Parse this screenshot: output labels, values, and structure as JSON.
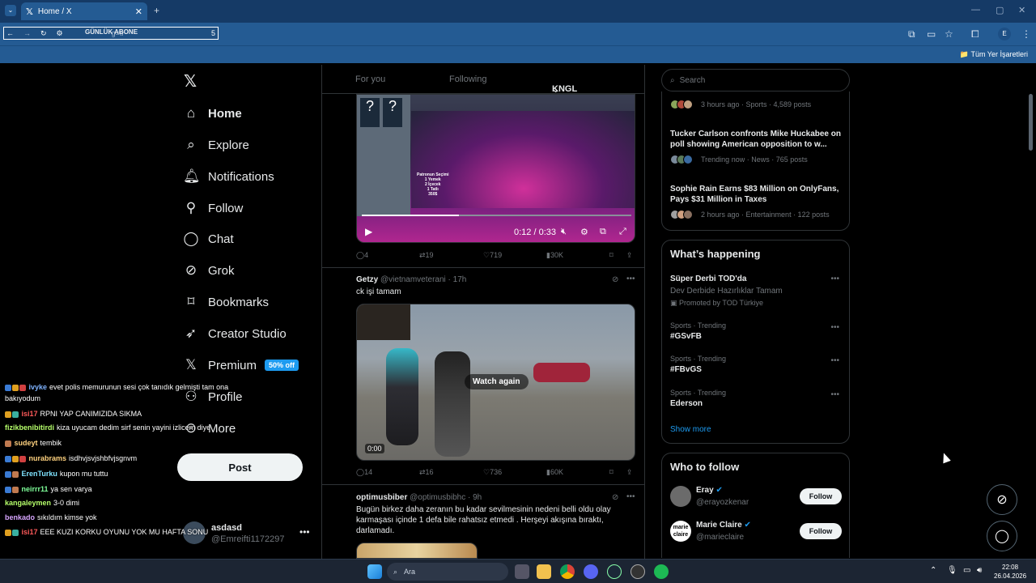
{
  "browser": {
    "tab_title": "Home / X",
    "address_overlay": "GÜNLÜK ABONE",
    "address_hint": "g=tr",
    "address_num": "5",
    "bookmarks_label": "Tüm Yer İşaretleri",
    "profile_letter": "E"
  },
  "nav": {
    "home": "Home",
    "explore": "Explore",
    "notifications": "Notifications",
    "follow": "Follow",
    "chat": "Chat",
    "grok": "Grok",
    "bookmarks": "Bookmarks",
    "creator_studio": "Creator Studio",
    "premium": "Premium",
    "premium_badge": "50% off",
    "profile": "Profile",
    "more": "More",
    "post": "Post"
  },
  "account": {
    "name": "asdasd",
    "handle": "@Emreifti1172297"
  },
  "feed": {
    "tabs": [
      "For you",
      "Following",
      "KNGL Social"
    ],
    "video1": {
      "overlay_lines": [
        "Patronun Seçimi",
        "1 Yemek",
        "2 İçecek",
        "1 Tatlı",
        "350$"
      ],
      "time": "0:12 / 0:33",
      "replies": "4",
      "reposts": "19",
      "likes": "719",
      "views": "30K"
    },
    "tweet2": {
      "name": "Getzy",
      "handle": "@vietnamveterani",
      "time": "· 17h",
      "text": "ck işi tamam",
      "watch_again": "Watch again",
      "video_time": "0:00",
      "replies": "14",
      "reposts": "16",
      "likes": "736",
      "views": "60K"
    },
    "tweet3": {
      "name": "optimusbiber",
      "handle": "@optimusbibhc",
      "time": "· 9h",
      "text": "Bugün birkez daha zeranın bu kadar sevilmesinin nedeni belli oldu olay karmaşası içinde 1 defa bile rahatsız etmedi . Herşeyi akışına bıraktı, darlamadı."
    }
  },
  "right": {
    "search_placeholder": "Search",
    "news": [
      {
        "title": "",
        "meta": "3 hours ago · Sports · 4,589 posts"
      },
      {
        "title": "Tucker Carlson confronts Mike Huckabee on poll showing American opposition to w...",
        "meta": "Trending now · News · 765 posts"
      },
      {
        "title": "Sophie Rain Earns $83 Million on OnlyFans, Pays $31 Million in Taxes",
        "meta": "2 hours ago · Entertainment · 122 posts"
      }
    ],
    "happening_title": "What’s happening",
    "promo": {
      "name": "Süper Derbi TOD'da",
      "desc": "Dev Derbide Hazırlıklar Tamam",
      "promoted": "Promoted by TOD Türkiye"
    },
    "trends": [
      {
        "context": "Sports · Trending",
        "name": "#GSvFB"
      },
      {
        "context": "Sports · Trending",
        "name": "#FBvGS"
      },
      {
        "context": "Sports · Trending",
        "name": "Ederson"
      }
    ],
    "show_more": "Show more",
    "who_title": "Who to follow",
    "who": [
      {
        "name": "Eray",
        "handle": "@erayozkenar",
        "button": "Follow"
      },
      {
        "name": "Marie Claire",
        "handle": "@marieclaire",
        "button": "Follow"
      }
    ]
  },
  "chat_overlay": [
    {
      "user": "ivyke",
      "msg": "evet polis memurunun sesi çok tanıdık gelmişti tam ona",
      "color": "#7fb3ff"
    },
    {
      "user": "",
      "msg": "bakıyodum",
      "color": "#ffffff"
    },
    {
      "user": "isi17",
      "msg": "RPNI YAP CANIMIZIDA SIKMA",
      "color": "#ff5a5a"
    },
    {
      "user": "fizikbenibitirdi",
      "msg": "kiza uyucam dedim sirf senin yayini izlicem diye",
      "color": "#b6ff6b"
    },
    {
      "user": "sudeyt",
      "msg": "tembik",
      "color": "#ffd27f"
    },
    {
      "user": "nurabrams",
      "msg": "isdhvjsvjshbfvjsgnvm",
      "color": "#ffd27f"
    },
    {
      "user": "ErenTurku",
      "msg": "kupon mu tuttu",
      "color": "#7fe3ff"
    },
    {
      "user": "neirrr11",
      "msg": "ya sen varya",
      "color": "#7fff9a"
    },
    {
      "user": "kangaleymen",
      "msg": "3-0 dimi",
      "color": "#b6ff6b"
    },
    {
      "user": "benkado",
      "msg": "sıkıldım kimse yok",
      "color": "#d8a6ff"
    },
    {
      "user": "isi17",
      "msg": "EEE KUZI KORKU OYUNU YOK MU HAFTA SONU",
      "color": "#ff5a5a"
    }
  ],
  "taskbar": {
    "search": "Ara",
    "time": "22:08",
    "date": "26.04.2026"
  }
}
